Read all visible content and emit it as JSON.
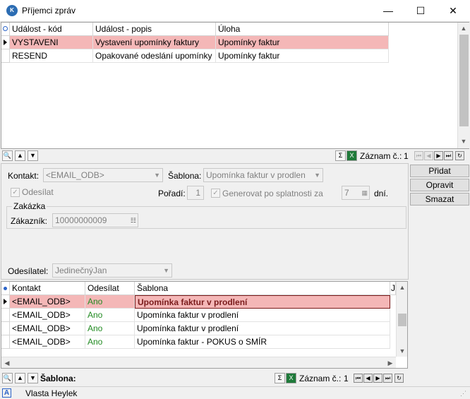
{
  "window": {
    "title": "Příjemci zpráv",
    "app_icon": "K",
    "minimize": "—",
    "maximize": "☐",
    "close": "✕"
  },
  "top_grid": {
    "headers": [
      "Událost - kód",
      "Událost - popis",
      "Úloha"
    ],
    "rows": [
      [
        "VYSTAVENI",
        "Vystavení upomínky faktury",
        "Upomínky faktur"
      ],
      [
        "RESEND",
        "Opakované odeslání upomínky",
        "Upomínky faktur"
      ]
    ],
    "selected_row_color": "#f4b7b7"
  },
  "top_toolbar": {
    "record_label": "Záznam č.:",
    "record_value": "1"
  },
  "form": {
    "kontakt_label": "Kontakt:",
    "kontakt_value": "<EMAIL_ODB>",
    "sablona_label": "Šablona:",
    "sablona_value": "Upomínka faktur v prodlen",
    "odesilat_label": "Odesílat",
    "poradi_label": "Pořadí:",
    "poradi_value": "1",
    "generovat_label": "Generovat po splatnosti za",
    "generovat_value": "7",
    "dni_label": "dní.",
    "zakazka_group": "Zakázka",
    "zakaznik_label": "Zákazník:",
    "zakaznik_value": "10000000009",
    "odesilatel_label": "Odesílatel:",
    "odesilatel_value": "JedinečnýJan"
  },
  "side_buttons": {
    "pridat": "Přidat",
    "opravit": "Opravit",
    "smazat": "Smazat"
  },
  "bottom_grid": {
    "headers": [
      "Kontakt",
      "Odesílat",
      "Šablona",
      "J"
    ],
    "rows": [
      [
        "<EMAIL_ODB>",
        "Ano",
        "Upomínka faktur v prodlení"
      ],
      [
        "<EMAIL_ODB>",
        "Ano",
        "Upomínka faktur v prodlení"
      ],
      [
        "<EMAIL_ODB>",
        "Ano",
        "Upomínka faktur v prodlení"
      ],
      [
        "<EMAIL_ODB>",
        "Ano",
        "Upomínka faktur - POKUS o SMÍR"
      ]
    ]
  },
  "bottom_toolbar": {
    "sablona_label": "Šablona:",
    "record_label": "Záznam č.:",
    "record_value": "1"
  },
  "status_bar": {
    "user": "Vlasta Heylek",
    "icon_letter": "A"
  }
}
